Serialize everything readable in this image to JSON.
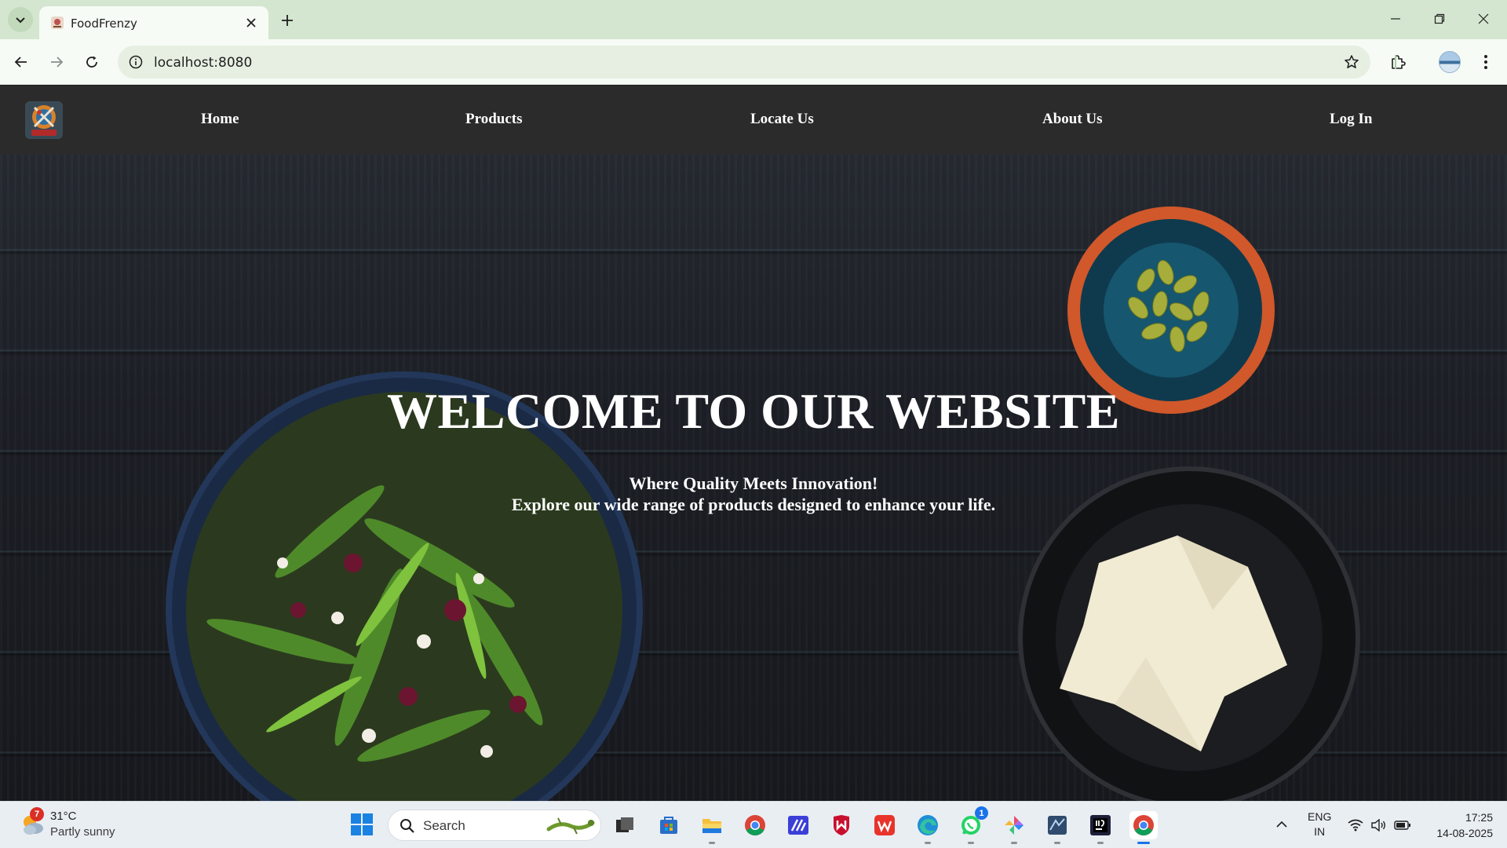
{
  "browser": {
    "tab_title": "FoodFrenzy",
    "url": "localhost:8080"
  },
  "site": {
    "nav": [
      {
        "label": "Home"
      },
      {
        "label": "Products"
      },
      {
        "label": "Locate Us"
      },
      {
        "label": "About Us"
      },
      {
        "label": "Log In"
      }
    ],
    "hero": {
      "title": "WELCOME TO OUR WEBSITE",
      "subtitle_line1": "Where Quality Meets Innovation!",
      "subtitle_line2": "Explore our wide range of products designed to enhance your life."
    }
  },
  "taskbar": {
    "weather": {
      "badge": "7",
      "temp": "31°C",
      "desc": "Partly sunny"
    },
    "search_label": "Search",
    "apps": [
      "task-view",
      "microsoft-store",
      "file-explorer",
      "chrome",
      "visual-studio",
      "mcafee",
      "wps-office",
      "edge",
      "whatsapp",
      "photos",
      "keyboard-app",
      "intellij",
      "chrome-active"
    ],
    "whatsapp_badge": "1",
    "language": "ENG",
    "region": "IN",
    "time": "17:25",
    "date": "14-08-2025"
  },
  "colors": {
    "tabstrip": "#d4e6cf",
    "nav_background": "#2b2b2b",
    "accent": "#1a73e8"
  }
}
